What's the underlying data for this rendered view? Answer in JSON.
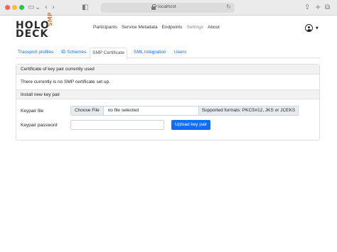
{
  "browser": {
    "url": "localhost"
  },
  "logo": {
    "line1": "HOLO",
    "line2": "DECK",
    "badge": "SMP"
  },
  "nav": {
    "items": [
      "Participants",
      "Service Metadata",
      "Endpoints",
      "Settings",
      "About"
    ],
    "active": "Settings"
  },
  "tabs": [
    "Transport profiles",
    "ID Schemes",
    "SMP Certificate",
    "SML Integration",
    "Users"
  ],
  "active_tab": "SMP Certificate",
  "current_section": {
    "header": "Certificate of key pair currently used",
    "message": "There currently is no SMP certificate set up."
  },
  "install_section": {
    "header": "Install new key pair",
    "keypair_file_label": "Keypair file",
    "choose_file_label": "Choose File",
    "file_status": "no file selected",
    "formats_hint": "Supported formats: PKCS#12, JKS or JCEKS",
    "password_label": "Keypair password",
    "password_value": "",
    "upload_label": "Upload key pair"
  },
  "colors": {
    "primary": "#0d6efd",
    "logo_accent": "#e07a2e"
  }
}
